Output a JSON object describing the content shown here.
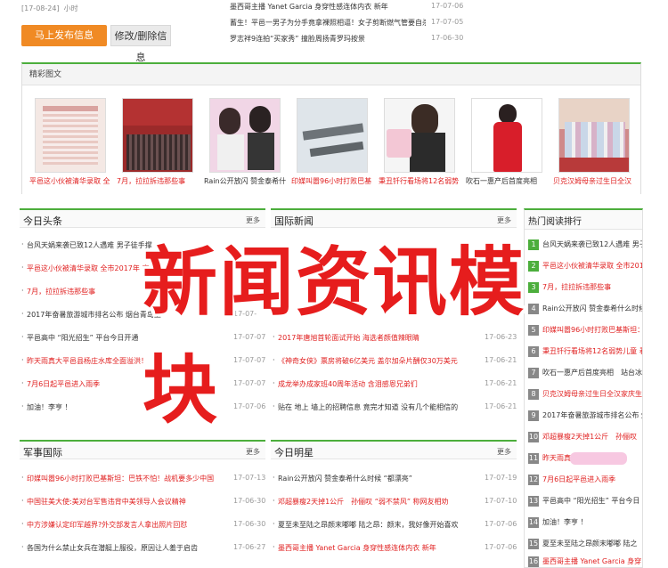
{
  "top_left": {
    "meta": "[17-08-24]",
    "meta_suffix": "小时",
    "publish_button": "马上发布信息",
    "edit_button": "修改/删除信息"
  },
  "top_news": [
    {
      "title": "墨西哥主播 Yanet Garcia 身穿性感连体内衣 新年",
      "date": "17-07-06"
    },
    {
      "title": "蓄生！平邑一男子为分手竟拿裸照相逼！女子剪断燃气管要自杀！",
      "date": "17-07-05"
    },
    {
      "title": "罗志祥9连拍“买家秀” 撞脸周扬青罗玛按景",
      "date": "17-06-30"
    }
  ],
  "gallery": {
    "title": "精彩图文",
    "items": [
      {
        "caption": "平邑这小伙被清华录取 全"
      },
      {
        "caption": "7月，拉拉拆违那些事"
      },
      {
        "caption": "Rain公开放闪 赞金泰希什"
      },
      {
        "caption": "印媒叫嚣96小时打败巴基"
      },
      {
        "caption": "秉丑钎行看场将12名弱势"
      },
      {
        "caption": "吹石一惠产后首度亮相"
      },
      {
        "caption": "贝克汉姆母亲过生日全汉"
      }
    ]
  },
  "headline": {
    "title": "今日头条",
    "more": "更多",
    "items": [
      {
        "text": "台风天娲来袭已致12人遇难 男子徒手撑",
        "date": ""
      },
      {
        "text": "平邑这小伙被清华录取 全市2017年 高考",
        "date": ""
      },
      {
        "text": "7月，拉拉拆违那些事",
        "date": ""
      },
      {
        "text": "2017年奋暑旅游城市排名公布 烟台青岛上",
        "date": "17-07-"
      },
      {
        "text": "平邑高中 “阳光招生” 平台今日开通",
        "date": "17-07-07"
      },
      {
        "text": "昨天雨真大平邑县杨庄水库全面溢洪！",
        "date": "17-07-07"
      },
      {
        "text": "7月6日起平邑进入雨季",
        "date": "17-07-07"
      },
      {
        "text": "加油！李亨 ！",
        "date": "17-07-06"
      }
    ]
  },
  "international": {
    "title": "国际新闻",
    "more": "更多",
    "items": [
      {
        "text": "",
        "date": ""
      },
      {
        "text": "",
        "date": ""
      },
      {
        "text": "",
        "date": ""
      },
      {
        "text": "",
        "date": ""
      },
      {
        "text": "2017年唐旭首轮面试开始 海选者颜值辣眼睛",
        "date": "17-06-23"
      },
      {
        "text": "《神奇女侠》票房将破6亿美元 盖尔加朵片酬仅30万美元",
        "date": "17-06-21"
      },
      {
        "text": "成龙举办成家班40周年活动 含泪感恩兄弟们",
        "date": "17-06-21"
      },
      {
        "text": "贴在 地上 墙上的招聘信息 竟完才知道 没有几个能相信的",
        "date": "17-06-21"
      }
    ]
  },
  "military": {
    "title": "军事国际",
    "more": "更多",
    "items": [
      {
        "text": "印媒叫嚣96小时打败巴基斯坦：巴铁不怕！战机要多少中国",
        "date": "17-07-13"
      },
      {
        "text": "中国驻美大使:美对台军售违背中美领导人会议精神",
        "date": "17-06-30"
      },
      {
        "text": "中方涉嫌认定印军越界?外交部发言人拿出照片回怼",
        "date": "17-06-30"
      },
      {
        "text": "各国为什么禁止女兵在潜艇上服役，原因让人羞于启齿",
        "date": "17-06-27"
      }
    ]
  },
  "stars": {
    "title": "今日明星",
    "more": "更多",
    "items": [
      {
        "text": "Rain公开放闪 赞金泰希什么时候 “都漂亮”",
        "date": "17-07-19"
      },
      {
        "text": "邓超暴瘦2天掉1公斤　孙俪叹 “弱不禁风” 称网友相劝",
        "date": "17-07-10"
      },
      {
        "text": "夏至未至陆之昂颜末嘟嘟 陆之昂：颜末，我好像开始喜欢",
        "date": "17-07-06"
      },
      {
        "text": "墨西哥主播 Yanet Garcia 身穿性感连体内衣 新年",
        "date": "17-07-06"
      }
    ]
  },
  "ranking": {
    "title": "热门阅读排行",
    "items": [
      {
        "num": "1",
        "text": "台风天娲来袭已致12人遇难 男子"
      },
      {
        "num": "2",
        "text": "平邑这小伙被清华录取 全市201"
      },
      {
        "num": "3",
        "text": "7月，拉拉拆违那些事"
      },
      {
        "num": "4",
        "text": "Rain公开放闪 赞金泰希什么时候"
      },
      {
        "num": "5",
        "text": "印媒叫嚣96小时打败巴基斯坦："
      },
      {
        "num": "6",
        "text": "秉丑钎行看场将12名弱势儿童 看"
      },
      {
        "num": "7",
        "text": "吹石一惠产后首度亮相　站台冰"
      },
      {
        "num": "8",
        "text": "贝克汉姆母亲过生日全汉家庆生"
      },
      {
        "num": "9",
        "text": "2017年奋暑旅游城市排名公布 烟"
      },
      {
        "num": "10",
        "text": "邓超暴瘦2天掉1公斤　孙俪叹"
      },
      {
        "num": "11",
        "text": "昨天雨真大"
      },
      {
        "num": "12",
        "text": "7月6日起平邑进入雨季"
      },
      {
        "num": "13",
        "text": "平邑高中 “阳光招生” 平台今日"
      },
      {
        "num": "14",
        "text": "加油！李亨 ！"
      },
      {
        "num": "15",
        "text": "夏至未至陆之昂颜末嘟嘟 陆之"
      },
      {
        "num": "16",
        "text": "墨西哥主播 Yanet Garcia 身穿"
      }
    ]
  },
  "overlay": {
    "text": "新闻资讯模块"
  },
  "colors": {
    "accent_green": "#4cae3c",
    "link_red": "#e02020",
    "overlay_red": "#e61d1d",
    "button_orange": "#f08a24"
  }
}
